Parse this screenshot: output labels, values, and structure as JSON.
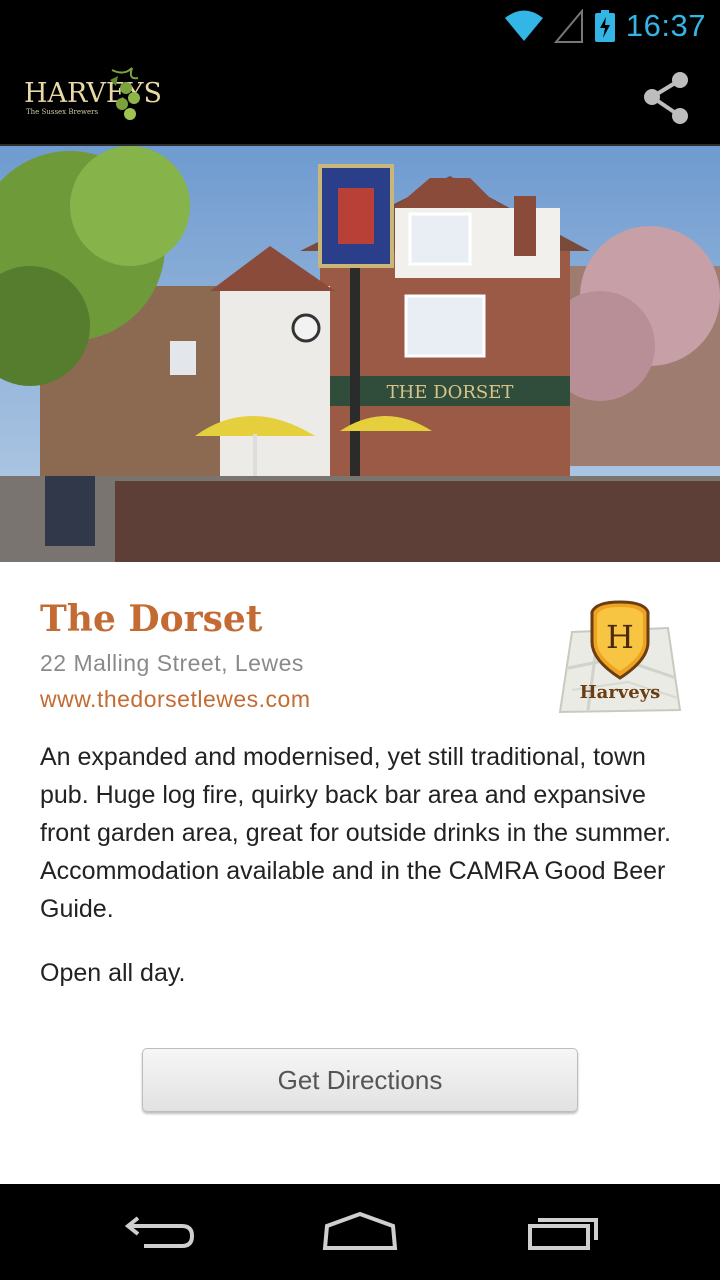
{
  "status_bar": {
    "time": "16:37",
    "icons": [
      "wifi-icon",
      "cell-signal-icon",
      "battery-charging-icon"
    ]
  },
  "action_bar": {
    "logo_text": "HARVEYS",
    "logo_tagline": "The Sussex Brewers",
    "share_icon": "share-icon"
  },
  "pub": {
    "name": "The Dorset",
    "address": "22 Malling Street, Lewes",
    "website": "www.thedorsetlewes.com",
    "sign_text": "THE DORSET",
    "map_badge_letter": "H",
    "map_badge_label": "Harveys",
    "description": "An expanded and modernised, yet still traditional, town pub. Huge log fire, quirky back bar area and expansive front garden area, great for outside drinks in the summer. Accommodation available and in the CAMRA Good Beer Guide.",
    "opening": "Open all day."
  },
  "buttons": {
    "directions": "Get Directions"
  },
  "nav_bar": {
    "icons": [
      "back-icon",
      "home-icon",
      "recent-apps-icon"
    ]
  },
  "colors": {
    "accent": "#c36b32",
    "status_time": "#33b5e5"
  }
}
